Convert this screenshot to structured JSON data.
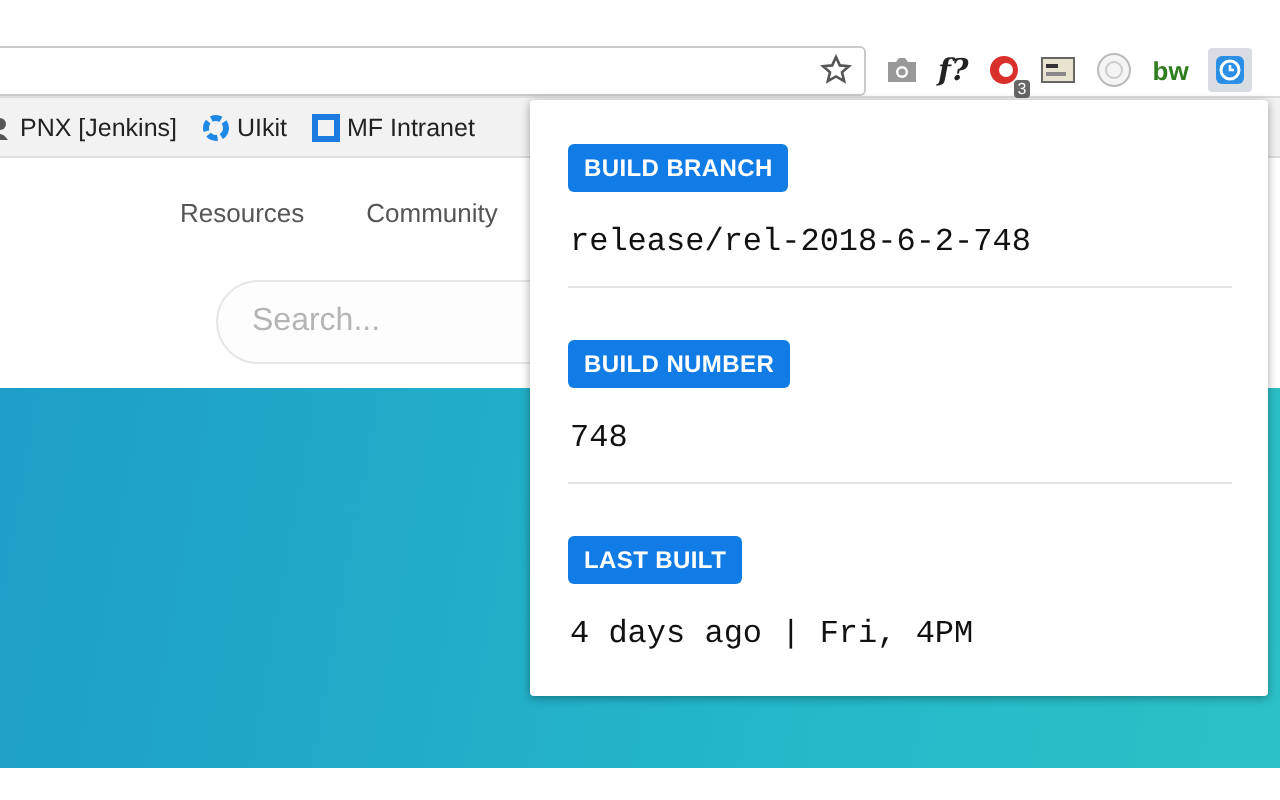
{
  "toolbar": {
    "extensions": [
      {
        "kind": "camera"
      },
      {
        "kind": "text",
        "label": "f?"
      },
      {
        "kind": "badge",
        "badge": "3"
      },
      {
        "kind": "card"
      },
      {
        "kind": "circle"
      },
      {
        "kind": "logo",
        "label": "bw"
      },
      {
        "kind": "active"
      }
    ]
  },
  "bookmarks": [
    {
      "label": "PNX [Jenkins]",
      "kind": "person"
    },
    {
      "label": "UIkit",
      "kind": "ring"
    },
    {
      "label": "MF Intranet",
      "kind": "square"
    }
  ],
  "page": {
    "nav": [
      "Resources",
      "Community"
    ],
    "search": {
      "placeholder": "Search..."
    }
  },
  "popup": {
    "sections": [
      {
        "label": "BUILD BRANCH",
        "value": "release/rel-2018-6-2-748"
      },
      {
        "label": "BUILD NUMBER",
        "value": "748"
      },
      {
        "label": "LAST BUILT",
        "value": "4 days ago | Fri, 4PM"
      }
    ]
  }
}
